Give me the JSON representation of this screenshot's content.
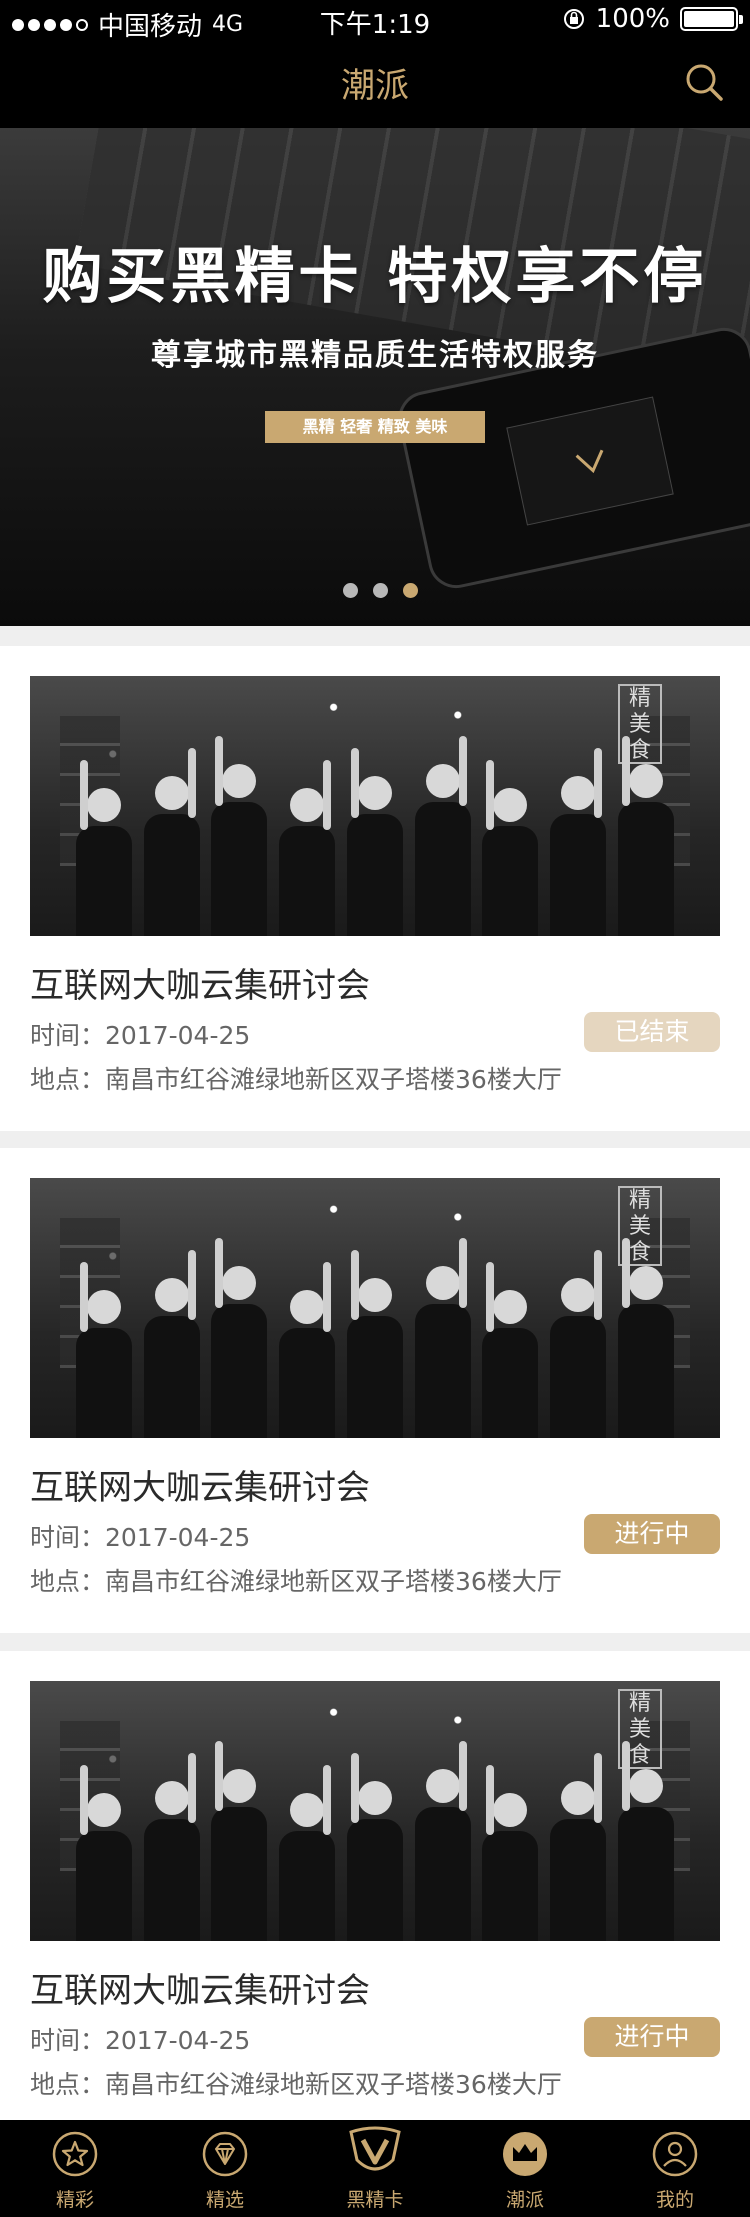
{
  "status_bar": {
    "carrier": "中国移动",
    "network": "4G",
    "time": "下午1:19",
    "battery": "100%"
  },
  "nav": {
    "title": "潮派",
    "search_icon": "search-icon"
  },
  "banner": {
    "title": "购买黑精卡  特权享不停",
    "subtitle": "尊享城市黑精品质生活特权服务",
    "tag": "黑精 轻奢 精致 美味",
    "dots": 3,
    "active_dot": 2
  },
  "events": [
    {
      "title": "互联网大咖云集研讨会",
      "time": "时间：2017-04-25",
      "location": "地点：南昌市红谷滩绿地新区双子塔楼36楼大厅",
      "status": "已结束",
      "status_type": "ended",
      "photo_sign": "精美食"
    },
    {
      "title": "互联网大咖云集研讨会",
      "time": "时间：2017-04-25",
      "location": "地点：南昌市红谷滩绿地新区双子塔楼36楼大厅",
      "status": "进行中",
      "status_type": "ongoing",
      "photo_sign": "精美食"
    },
    {
      "title": "互联网大咖云集研讨会",
      "time": "时间：2017-04-25",
      "location": "地点：南昌市红谷滩绿地新区双子塔楼36楼大厅",
      "status": "进行中",
      "status_type": "ongoing",
      "photo_sign": "精美食"
    }
  ],
  "tabs": [
    {
      "label": "精彩",
      "icon": "star-circle-icon"
    },
    {
      "label": "精选",
      "icon": "diamond-circle-icon"
    },
    {
      "label": "黑精卡",
      "icon": "v-shield-icon"
    },
    {
      "label": "潮派",
      "icon": "crown-circle-icon",
      "active": true
    },
    {
      "label": "我的",
      "icon": "user-circle-icon"
    }
  ],
  "colors": {
    "gold": "#c9a871",
    "gold_light": "#e5d6bf",
    "black": "#000000",
    "page_bg": "#efefef"
  }
}
